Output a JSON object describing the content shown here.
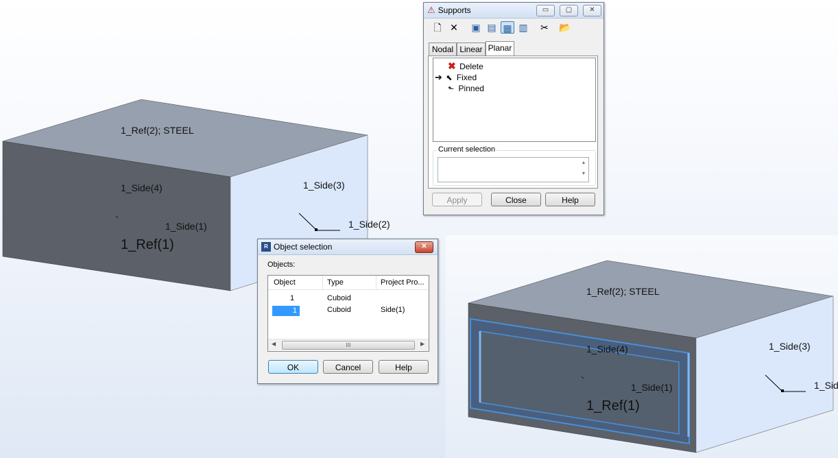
{
  "scene_left": {
    "labels": {
      "ref2": "1_Ref(2); STEEL",
      "side4": "1_Side(4)",
      "side3": "1_Side(3)",
      "side1": "1_Side(1)",
      "side2": "1_Side(2)",
      "ref1": "1_Ref(1)"
    }
  },
  "scene_right": {
    "labels": {
      "ref2": "1_Ref(2); STEEL",
      "side4": "1_Side(4)",
      "side3": "1_Side(3)",
      "side1": "1_Side(1)",
      "side2": "1_Sid",
      "ref1": "1_Ref(1)"
    }
  },
  "supports_dialog": {
    "title": "Supports",
    "tabs": [
      "Nodal",
      "Linear",
      "Planar"
    ],
    "active_tab": "Planar",
    "items": [
      {
        "label": "Delete",
        "icon": "delete-x-icon"
      },
      {
        "label": "Fixed",
        "icon": "fixed-support-icon",
        "selected": true
      },
      {
        "label": "Pinned",
        "icon": "pinned-support-icon"
      }
    ],
    "current_selection_label": "Current selection",
    "current_selection_value": "",
    "buttons": {
      "apply": "Apply",
      "close": "Close",
      "help": "Help"
    }
  },
  "object_dialog": {
    "title": "Object selection",
    "objects_label": "Objects:",
    "columns": [
      "Object",
      "Type",
      "Project Pro..."
    ],
    "rows": [
      {
        "object": "1",
        "type": "Cuboid",
        "project": ""
      },
      {
        "object": "1",
        "type": "Cuboid",
        "project": "Side(1)",
        "selected": true
      }
    ],
    "scroll_grip": "III",
    "buttons": {
      "ok": "OK",
      "cancel": "Cancel",
      "help": "Help"
    }
  }
}
